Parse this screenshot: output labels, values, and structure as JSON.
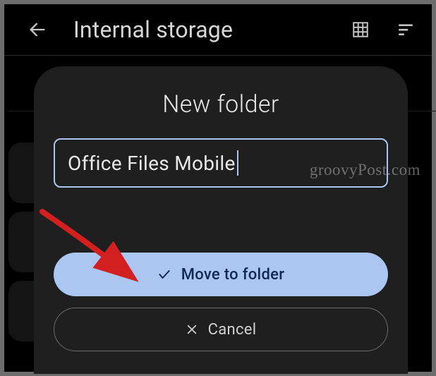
{
  "header": {
    "title": "Internal storage"
  },
  "dialog": {
    "title": "New folder",
    "input_value": "Office Files Mobile",
    "primary_label": "Move to folder",
    "secondary_label": "Cancel"
  },
  "watermark": "groovyPost.com"
}
